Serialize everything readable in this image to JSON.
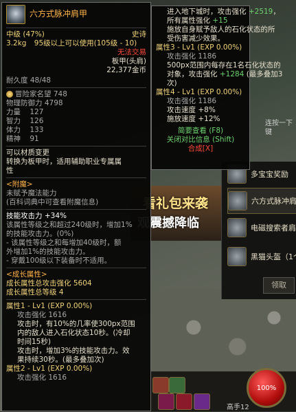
{
  "background": {
    "banner_line1": "看礼包来袭",
    "banner_line2": "观震撼降临",
    "hint": "连按一下键"
  },
  "mail": {
    "items": [
      {
        "label": "多宝宝奖励"
      },
      {
        "label": "六方式脉冲肩"
      },
      {
        "label": "电磁搜索者肩"
      },
      {
        "label": "黑猫头盔（1个"
      }
    ],
    "button": "领取"
  },
  "hud": {
    "hp": "100%",
    "level": "高手12"
  },
  "item": {
    "name": "六方式脉冲肩甲",
    "grade": "中级",
    "grade_pct": "(47%)",
    "rarity": "史诗",
    "weight": "3.2kg",
    "level_req": "95级以上可以使用(105级 - 10)",
    "untradeable": "无法交易",
    "type": "板甲(头肩)",
    "price": "22,377金币",
    "durability_label": "耐久度",
    "durability": "48/48",
    "adventurer_label": "冒险家名望",
    "adventurer_value": "748",
    "stats": [
      {
        "label": "物理防御力",
        "value": "4798"
      },
      {
        "label": "力量",
        "value": "127"
      },
      {
        "label": "智力",
        "value": "126"
      },
      {
        "label": "体力",
        "value": "133"
      },
      {
        "label": "精神",
        "value": "91"
      }
    ],
    "material_change": "可以材质变更",
    "convert_line1": "转换为板甲时，适用辅助职业专属属",
    "convert_line2": "性",
    "enchant_header": "<附魔>",
    "enchant_line1": "未赋予魔法能力",
    "enchant_line2": "(百科词典中可查看附魔信息)",
    "skill_header": "技能攻击力 +34%",
    "skill_lines": [
      "该属性等级之和超过240级时，增加1%",
      "的技能攻击力。(0%)",
      "- 该属性等级之和每增加40级时，额",
      "外增加1%的技能攻击力。",
      "- 穿戴100级以下装备时不适用。"
    ],
    "growth_header": "<成长属性>",
    "growth_total_atk": "成长属性总攻击强化 5604",
    "growth_total_lvl": "成长属性总等级 4",
    "attr1_header": "属性1 - Lv1 (EXP 0.00%)",
    "attr1_atk": "攻击强化 1616",
    "attr1_lines": [
      "攻击时，有10%的几率使300px范围",
      "内的敌人进入石化状态10秒。(冷却",
      "时间15秒)",
      "攻击时，增加3%的技能攻击力。效",
      "果持续30秒。(最多叠加次)"
    ],
    "attr2_header": "属性2 - Lv1 (EXP 0.00%)",
    "attr2_atk": "攻击强化 1616"
  },
  "compare": {
    "top_lines": [
      {
        "text": "进入地下城时，攻击强化 ",
        "bonus": "+2519",
        "tail": "，"
      },
      {
        "text": "所有属性强化 ",
        "bonus": "+15",
        "tail": ""
      },
      {
        "text": "施放自身赋予敌人的石化状态的所",
        "bonus": "",
        "tail": ""
      },
      {
        "text": "受伤害减少效果。",
        "bonus": "",
        "tail": ""
      }
    ],
    "attr3_header": "属性3 - Lv1 (EXP 0.00%)",
    "attr3_atk": "攻击强化 1186",
    "attr3_line1": "500px范围内每存在1名石化状态的",
    "attr3_line2a": "对象，攻击强化 ",
    "attr3_bonus": "+1284",
    "attr3_line2b": " (最多叠加3",
    "attr3_line3": "次)",
    "attr4_header": "属性4 - Lv1 (EXP 0.00%)",
    "attr4_atk": "攻击强化 1186",
    "attr4_speed1": "攻击速度 +8%",
    "attr4_speed2": "施放速度 +12%",
    "brief": "简要查看 (F8)",
    "close_compare": "关闭对比信息 (Shift)",
    "synthesize": "合成[X]"
  },
  "colors": {
    "rarity_epic": "#ffb44a",
    "positive": "#6ed26e",
    "warning": "#ff4a3a",
    "gold": "#f0d27a"
  }
}
